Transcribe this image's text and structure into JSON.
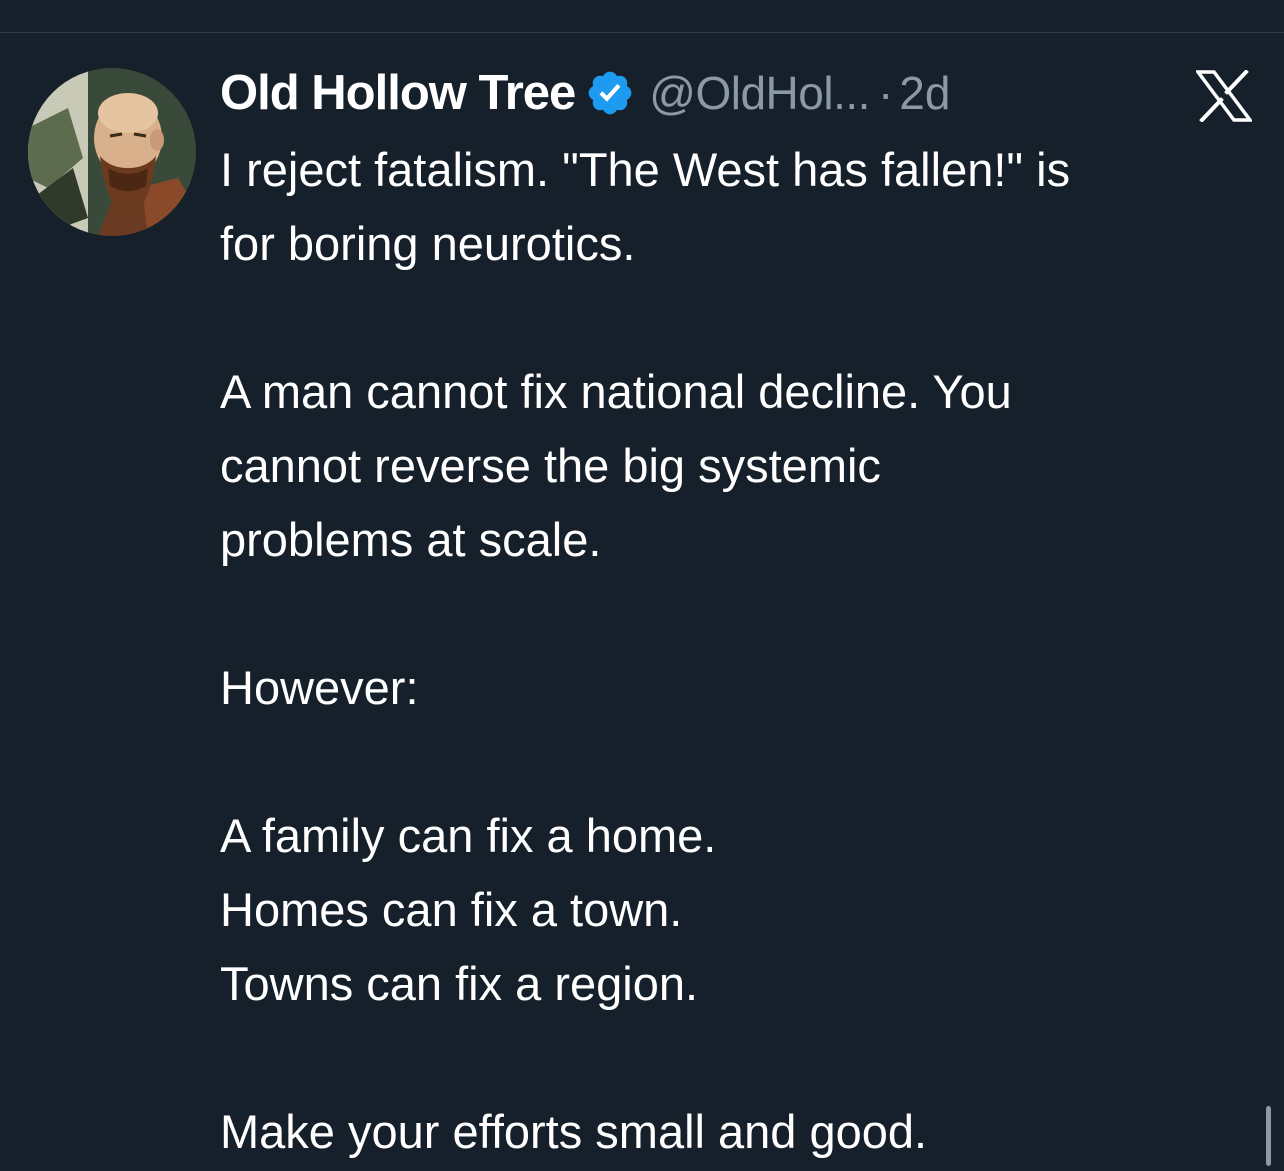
{
  "tweet": {
    "author": {
      "display_name": "Old Hollow Tree",
      "handle": "@OldHol...",
      "verified": true,
      "avatar": "bearded-man-illustration"
    },
    "separator": "·",
    "timestamp": "2d",
    "platform_icon": "x-logo-icon",
    "lines": [
      "I reject fatalism. \"The West has fallen!\" is",
      "for boring neurotics.",
      "",
      "A man cannot fix national decline. You",
      "cannot reverse the big systemic",
      "problems at scale.",
      "",
      "However:",
      "",
      "A family can fix a home.",
      "Homes can fix a town.",
      "Towns can fix a region.",
      "",
      "Make your efforts small and good."
    ]
  },
  "colors": {
    "background": "#15202b",
    "text_primary": "#ffffff",
    "text_secondary": "#8b98a5",
    "verified_blue": "#1d9bf0"
  }
}
